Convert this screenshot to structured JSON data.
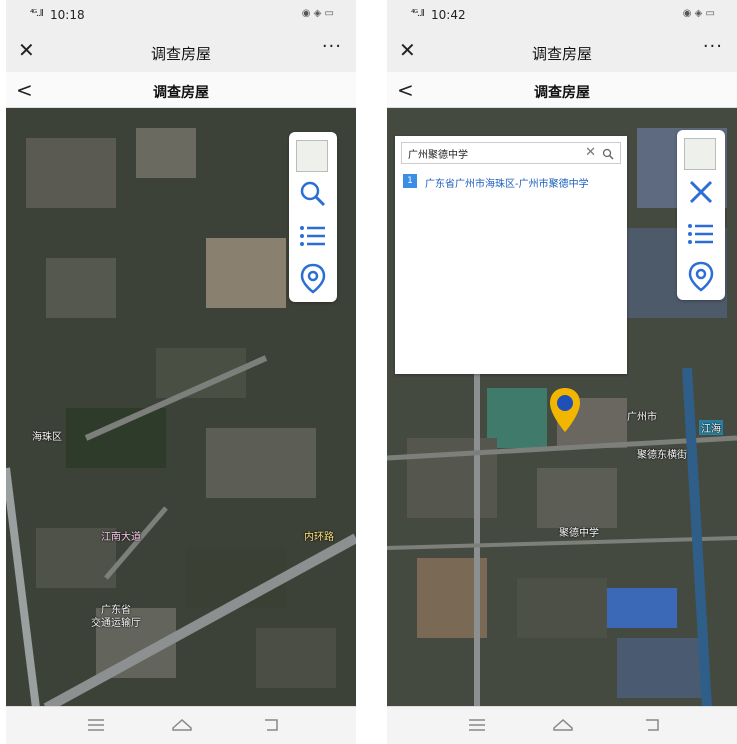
{
  "left": {
    "status": {
      "signal": "⁴ᴳ..ll",
      "time": "10:18"
    },
    "nav": {
      "close": "✕",
      "title": "调查房屋",
      "more": "···"
    },
    "sub": {
      "back": "<",
      "title": "调查房屋"
    },
    "map_labels": [
      "广东省",
      "交通运输厅",
      "内环路",
      "海珠区",
      "江南大道"
    ],
    "tools": [
      "layer-icon",
      "search-icon",
      "list-icon",
      "location-icon"
    ]
  },
  "right": {
    "status": {
      "signal": "⁴ᴳ..ll",
      "time": "10:42"
    },
    "nav": {
      "close": "✕",
      "title": "调查房屋",
      "more": "···"
    },
    "sub": {
      "back": "<",
      "title": "调查房屋"
    },
    "search": {
      "value": "广州聚德中学",
      "clear": "✕",
      "results": [
        {
          "index": "1",
          "text": "广东省广州市海珠区-广州市聚德中学"
        }
      ]
    },
    "map_labels": [
      "聚德中学",
      "江海",
      "广州市",
      "聚德东横街"
    ],
    "tools": [
      "layer-icon",
      "close-icon",
      "list-icon",
      "location-icon"
    ]
  },
  "colors": {
    "icon_blue": "#2b6fd6",
    "pin_yellow": "#f2b600",
    "result_blue": "#1c5fbf"
  }
}
